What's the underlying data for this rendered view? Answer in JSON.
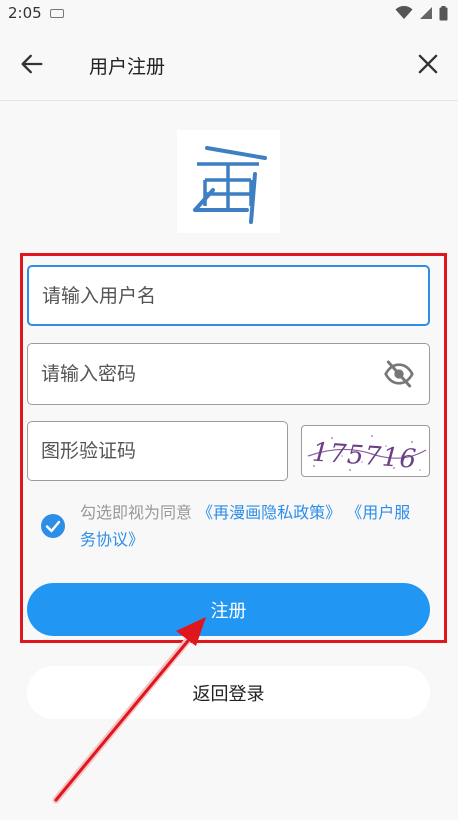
{
  "status_bar": {
    "time": "2:05"
  },
  "header": {
    "title": "用户注册"
  },
  "form": {
    "username_placeholder": "请输入用户名",
    "password_placeholder": "请输入密码",
    "captcha_placeholder": "图形验证码",
    "captcha_image_text": "175716"
  },
  "agreement": {
    "prefix": "勾选即视为同意",
    "privacy_link": "《再漫画隐私政策》",
    "service_link": "《用户服务协议》",
    "checked": true
  },
  "buttons": {
    "register": "注册",
    "back_to_login": "返回登录"
  },
  "colors": {
    "accent": "#2196f3",
    "highlight": "#e0161e"
  }
}
